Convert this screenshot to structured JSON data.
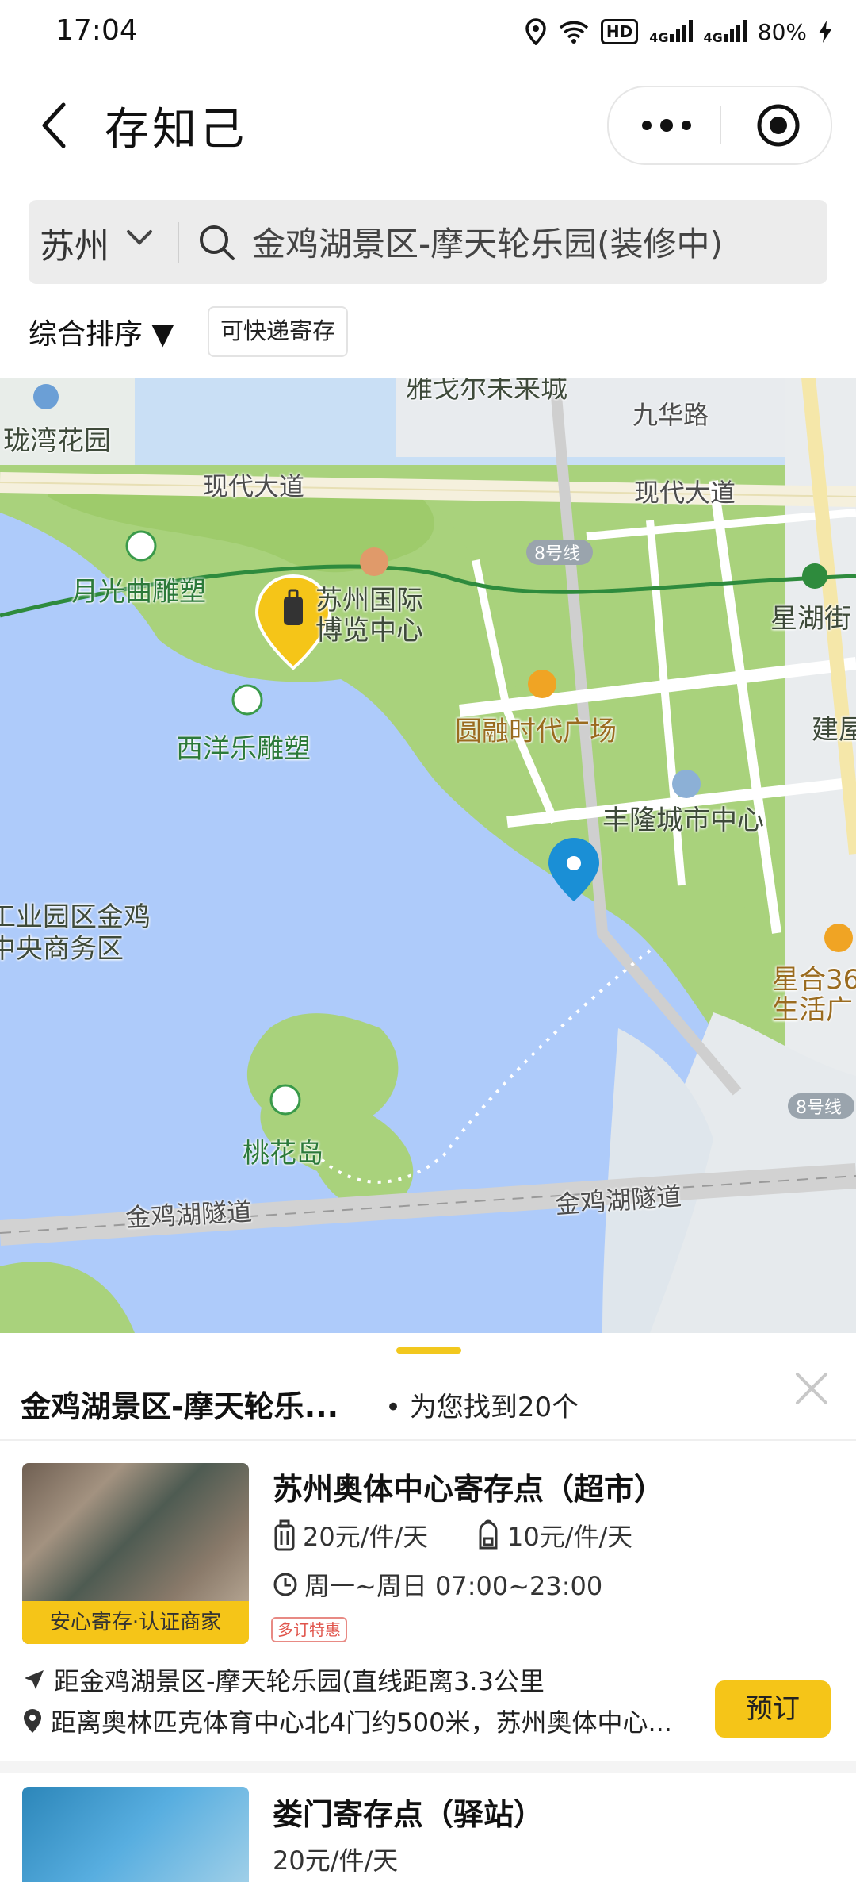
{
  "status_bar": {
    "time": "17:04",
    "hd_label": "HD",
    "net1": "4G",
    "net2": "4G",
    "battery": "80%"
  },
  "header": {
    "title": "存知己"
  },
  "search": {
    "city": "苏州",
    "query": "金鸡湖景区-摩天轮乐园(装修中)"
  },
  "filters": {
    "sort_label": "综合排序 ▼",
    "chip": "可快递寄存"
  },
  "map": {
    "labels": {
      "longwan": "珑湾花园",
      "yage": "雅戈尔未来城",
      "jiuhua": "九华路",
      "xiandai1": "现代大道",
      "xiandai2": "现代大道",
      "line8a": "8号线",
      "yueguang": "月光曲雕塑",
      "expo": "苏州国际\n博览中心",
      "xinghu": "星湖街",
      "xiyang": "西洋乐雕塑",
      "yuanrong": "圆融时代广场",
      "jianwu": "建屋",
      "fenglong": "丰隆城市中心",
      "gongye": "工业园区金鸡\n中央商务区",
      "xinghe": "星合36\n生活广",
      "line8b": "8号线",
      "taohua": "桃花岛",
      "tunnel1": "金鸡湖隧道",
      "tunnel2": "金鸡湖隧道"
    }
  },
  "sheet": {
    "title": "金鸡湖景区-摩天轮乐...",
    "count": "• 为您找到20个",
    "items": [
      {
        "name": "苏州奥体中心寄存点（超市）",
        "badge": "安心寄存·认证商家",
        "price_luggage": "20元/件/天",
        "price_bag": "10元/件/天",
        "hours": "周一~周日 07:00~23:00",
        "promo": "多订特惠",
        "distance": "距金鸡湖景区-摩天轮乐园(直线距离3.3公里",
        "address": "距离奥林匹克体育中心北4门约500米，苏州奥体中心...",
        "book": "预订"
      },
      {
        "name": "娄门寄存点（驿站）",
        "price_luggage": "20元/件/天"
      }
    ]
  },
  "colors": {
    "accent": "#f5c518",
    "map_land": "#a9d27c",
    "map_water": "#aecbfa",
    "pin_blue": "#1a8fd6"
  }
}
